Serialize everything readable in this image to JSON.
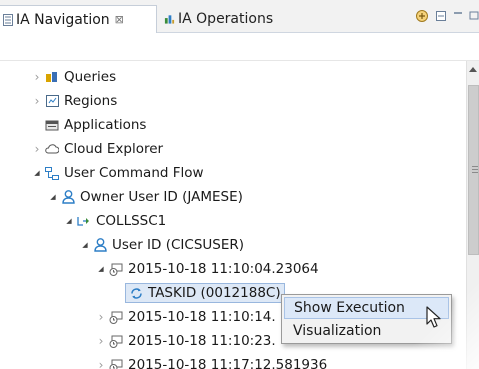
{
  "tabs": [
    {
      "label": "IA Navigation",
      "close": "⊠",
      "active": true,
      "icon": "navigation-icon"
    },
    {
      "label": "IA Operations",
      "active": false,
      "icon": "operations-icon"
    }
  ],
  "tree": {
    "items": [
      {
        "label": "Queries",
        "icon": "queries-icon",
        "twisty": "›"
      },
      {
        "label": "Regions",
        "icon": "regions-icon",
        "twisty": "›"
      },
      {
        "label": "Applications",
        "icon": "applications-icon",
        "twisty": ""
      },
      {
        "label": "Cloud Explorer",
        "icon": "cloud-explorer-icon",
        "twisty": "›"
      },
      {
        "label": "User Command Flow",
        "icon": "command-flow-icon",
        "twisty": "◢"
      },
      {
        "label": "Owner User ID (JAMESE)",
        "icon": "user-icon",
        "twisty": "◢"
      },
      {
        "label": "COLLSSC1",
        "icon": "system-icon",
        "twisty": "◢"
      },
      {
        "label": "User ID (CICSUSER)",
        "icon": "user-icon",
        "twisty": "◢"
      },
      {
        "label": "2015-10-18 11:10:04.23064",
        "icon": "timestamp-icon",
        "twisty": "◢"
      },
      {
        "label": "TASKID (0012188C)",
        "icon": "task-icon",
        "twisty": ""
      },
      {
        "label": "2015-10-18 11:10:14.",
        "icon": "timestamp-icon",
        "twisty": "›"
      },
      {
        "label": "2015-10-18 11:10:23.",
        "icon": "timestamp-icon",
        "twisty": "›"
      },
      {
        "label": "2015-10-18 11:17:12.581936",
        "icon": "timestamp-icon",
        "twisty": "›"
      }
    ]
  },
  "context_menu": {
    "items": [
      {
        "label": "Show Execution"
      },
      {
        "label": "Visualization"
      }
    ]
  },
  "colors": {
    "selection_bg": "#dde8f6",
    "menu_hover": "#dce8f8",
    "user_icon": "#2d7ec6"
  }
}
